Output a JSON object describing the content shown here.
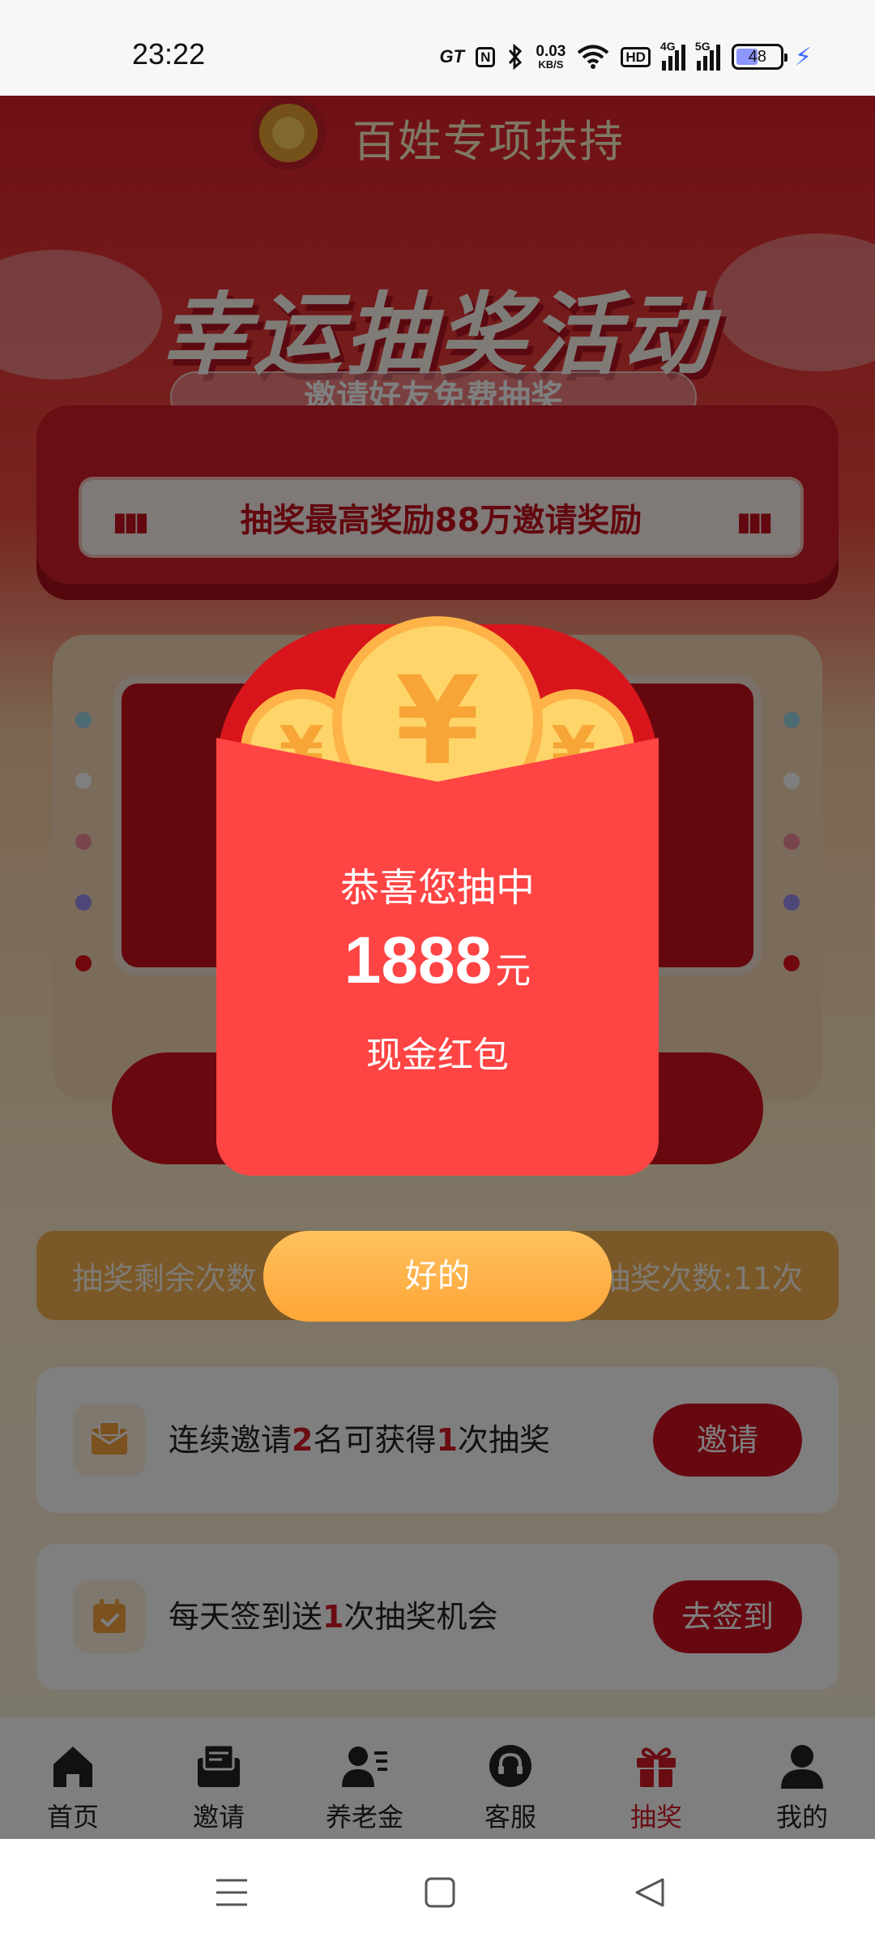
{
  "status_bar": {
    "time": "23:22",
    "gt_label": "GT",
    "nfc_label": "N",
    "speed_value": "0.03",
    "speed_unit": "KB/S",
    "hd_label": "HD",
    "sig1_label": "4G",
    "sig2_label": "5G",
    "battery": "48"
  },
  "header": {
    "title": "百姓专项扶持"
  },
  "banner": {
    "title": "幸运抽奖活动",
    "subtitle": "邀请好友免费抽奖",
    "marquee": "抽奖最高奖励88万邀请奖励"
  },
  "counts": {
    "remaining": "抽奖剩余次数",
    "total": "抽奖次数:11次"
  },
  "tasks": [
    {
      "text_a": "连续邀请",
      "hl_a": "2",
      "text_b": "名可获得",
      "hl_b": "1",
      "text_c": "次抽奖",
      "button": "邀请"
    },
    {
      "text_a": "每天签到送",
      "hl_a": "1",
      "text_b": "次抽奖机会",
      "button": "去签到"
    }
  ],
  "tabs": [
    {
      "label": "首页",
      "icon": "home-icon"
    },
    {
      "label": "邀请",
      "icon": "envelope-icon"
    },
    {
      "label": "养老金",
      "icon": "user-list-icon"
    },
    {
      "label": "客服",
      "icon": "headset-icon"
    },
    {
      "label": "抽奖",
      "icon": "gift-icon",
      "active": true
    },
    {
      "label": "我的",
      "icon": "person-icon"
    }
  ],
  "modal": {
    "coin_symbol": "¥",
    "congrats": "恭喜您抽中",
    "amount": "1888",
    "unit": "元",
    "prize": "现金红包",
    "ok_button": "好的"
  },
  "colors": {
    "primary_red": "#d2101c",
    "envelope": "#ff4444",
    "ok_button": "#ffa637",
    "active_tab": "#d41a26"
  }
}
